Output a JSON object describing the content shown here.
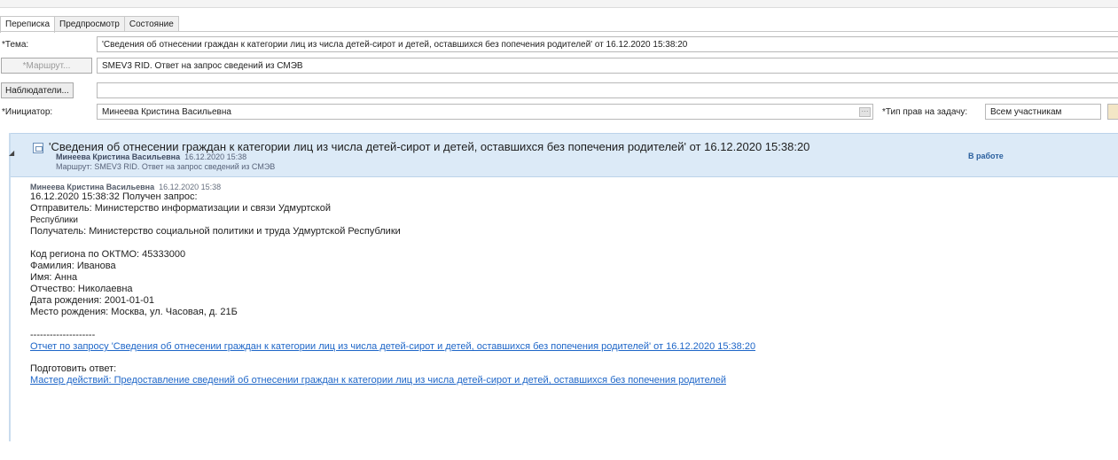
{
  "tabs": [
    "Переписка",
    "Предпросмотр",
    "Состояние"
  ],
  "form": {
    "subject_label": "*Тема:",
    "subject_value": "'Сведения об отнесении граждан к категории лиц из числа детей-сирот и детей, оставшихся без попечения родителей' от 16.12.2020 15:38:20",
    "route_button": "*Маршрут...",
    "route_value": "SMEV3 RID. Ответ на запрос сведений из СМЭВ",
    "observers_button": "Наблюдатели...",
    "observers_value": "",
    "initiator_label": "*Инициатор:",
    "initiator_value": "Минеева Кристина Васильевна",
    "rights_label": "*Тип прав на задачу:",
    "rights_value": "Всем участникам"
  },
  "message": {
    "title": "'Сведения об отнесении граждан к категории лиц из числа детей-сирот и детей, оставшихся без попечения родителей' от 16.12.2020 15:38:20",
    "author": "Минеева Кристина Васильевна",
    "datetime": "16.12.2020 15:38",
    "route": "Маршрут: SMEV3 RID. Ответ на запрос сведений из СМЭВ",
    "status": "В работе",
    "body": {
      "author": "Минеева Кристина Васильевна",
      "datetime": "16.12.2020 15:38",
      "line1": "16.12.2020 15:38:32 Получен запрос:",
      "line2": "Отправитель: Министерство информатизации и связи Удмуртской",
      "line3": "Республики",
      "line4": "Получатель: Министерство социальной политики и труда Удмуртской Республики",
      "region": "Код региона по ОКТМО: 45333000",
      "surname": "Фамилия: Иванова",
      "name": "Имя: Анна",
      "patronymic": "Отчество: Николаевна",
      "birthdate": "Дата рождения: 2001-01-01",
      "birthplace": "Место рождения: Москва, ул. Часовая, д. 21Б",
      "separator": "--------------------",
      "report_link": "Отчет по запросу 'Сведения об отнесении граждан к категории лиц из числа детей-сирот и детей, оставшихся без попечения родителей' от 16.12.2020 15:38:20",
      "prepare": "Подготовить ответ:",
      "wizard_link": "Мастер действий: Предоставление сведений об отнесении граждан к категории лиц из числа детей-сирот и детей, оставшихся без попечения родителей"
    }
  }
}
